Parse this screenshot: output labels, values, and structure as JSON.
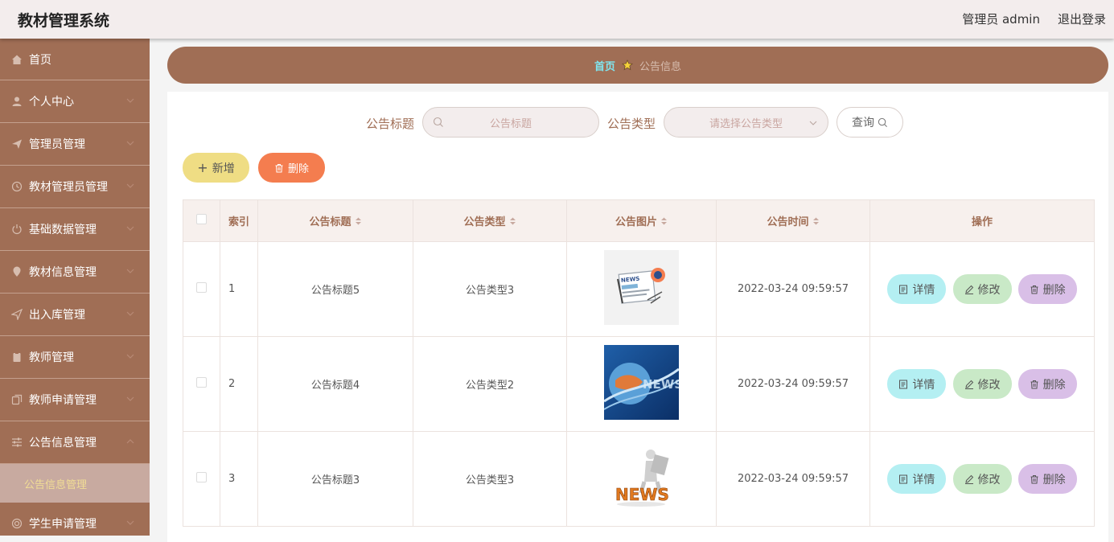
{
  "header": {
    "title": "教材管理系统",
    "user": "管理员 admin",
    "logout": "退出登录"
  },
  "sidebar": {
    "items": [
      {
        "label": "首页",
        "icon": "home-icon"
      },
      {
        "label": "个人中心",
        "icon": "user-icon"
      },
      {
        "label": "管理员管理",
        "icon": "send-icon"
      },
      {
        "label": "教材管理员管理",
        "icon": "clock-icon"
      },
      {
        "label": "基础数据管理",
        "icon": "power-icon"
      },
      {
        "label": "教材信息管理",
        "icon": "location-icon"
      },
      {
        "label": "出入库管理",
        "icon": "navigation-icon"
      },
      {
        "label": "教师管理",
        "icon": "clipboard-icon"
      },
      {
        "label": "教师申请管理",
        "icon": "copy-icon"
      },
      {
        "label": "公告信息管理",
        "icon": "sliders-icon"
      }
    ],
    "active_sub": "公告信息管理",
    "after": {
      "label": "学生申请管理",
      "icon": "circle-icon"
    }
  },
  "breadcrumb": {
    "home": "首页",
    "current": "公告信息"
  },
  "search": {
    "title_label": "公告标题",
    "title_placeholder": "公告标题",
    "type_label": "公告类型",
    "type_placeholder": "请选择公告类型",
    "query": "查询"
  },
  "actions": {
    "add": "新增",
    "delete": "删除"
  },
  "table": {
    "headers": {
      "index": "索引",
      "title": "公告标题",
      "type": "公告类型",
      "image": "公告图片",
      "time": "公告时间",
      "ops": "操作"
    },
    "rows": [
      {
        "index": "1",
        "title": "公告标题5",
        "type": "公告类型3",
        "image": "news-paper-icon",
        "time": "2022-03-24 09:59:57"
      },
      {
        "index": "2",
        "title": "公告标题4",
        "type": "公告类型2",
        "image": "news-globe-icon",
        "time": "2022-03-24 09:59:57"
      },
      {
        "index": "3",
        "title": "公告标题3",
        "type": "公告类型3",
        "image": "news-person-icon",
        "time": "2022-03-24 09:59:57"
      }
    ],
    "ops": {
      "detail": "详情",
      "edit": "修改",
      "delete": "删除"
    }
  }
}
